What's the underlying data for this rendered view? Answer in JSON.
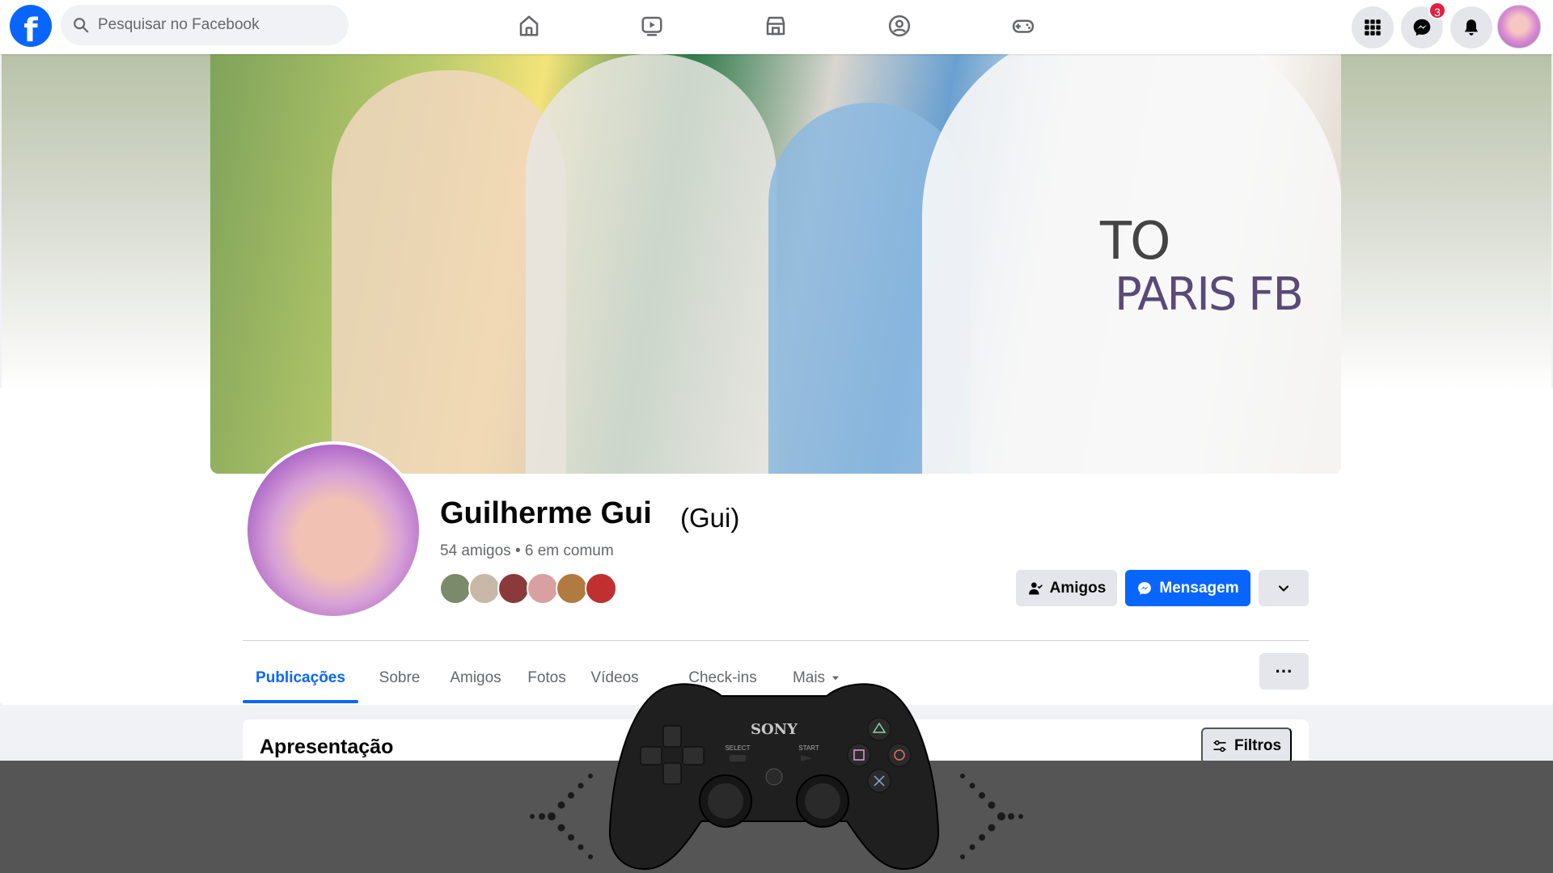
{
  "topbar": {
    "search_placeholder": "Pesquisar no Facebook",
    "nav_icons": [
      "home-icon",
      "video-icon",
      "marketplace-icon",
      "groups-icon",
      "gaming-icon"
    ],
    "right_icons": [
      "menu-grid-icon",
      "messenger-icon",
      "notifications-icon"
    ],
    "messenger_badge": "3"
  },
  "profile": {
    "name": "Guilherme Gui",
    "nickname": "(Gui)",
    "friends_count": "54 amigos",
    "mutual": "6 em comum",
    "separator": "•",
    "friends_button": "Amigos",
    "message_button": "Mensagem"
  },
  "tabs": {
    "items": [
      "Publicações",
      "Sobre",
      "Amigos",
      "Fotos",
      "Vídeos",
      "Check-ins",
      "Mais"
    ],
    "active": "Publicações",
    "more_label": "···"
  },
  "intro": {
    "title": "Apresentação",
    "filters_button": "Filtros"
  },
  "cover": {
    "shirt_text_1": "TO",
    "shirt_text_2": "PARIS FB"
  },
  "controller": {
    "brand": "SONY",
    "select_label": "SELECT",
    "start_label": "START"
  },
  "colors": {
    "accent": "#0866ff",
    "badge": "#e41e3f",
    "overlay": "#555555"
  }
}
